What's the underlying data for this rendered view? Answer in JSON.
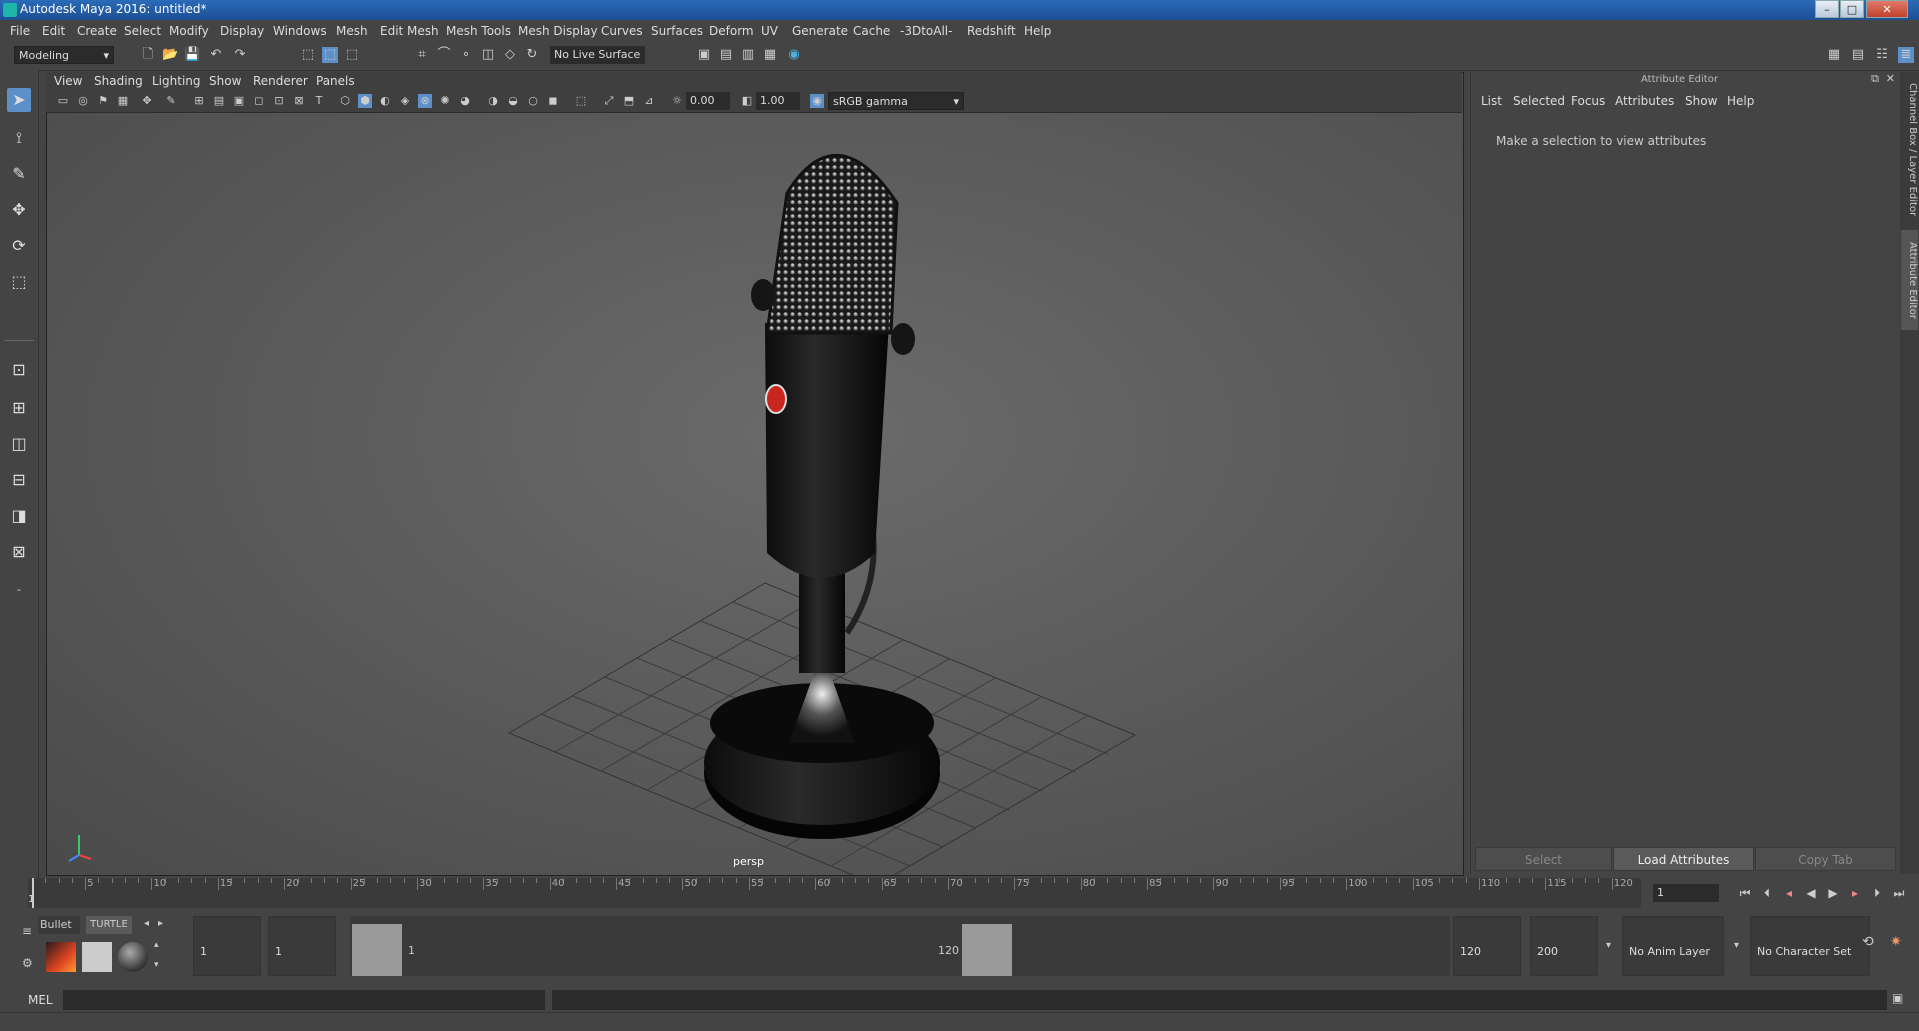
{
  "window": {
    "title": "Autodesk Maya 2016: untitled*"
  },
  "menubar": {
    "items": [
      "File",
      "Edit",
      "Create",
      "Select",
      "Modify",
      "Display",
      "Windows",
      "Mesh",
      "Edit Mesh",
      "Mesh Tools",
      "Mesh Display",
      "Curves",
      "Surfaces",
      "Deform",
      "UV",
      "Generate",
      "Cache",
      "-3DtoAll-",
      "Redshift",
      "Help"
    ]
  },
  "toolbar": {
    "mode": "Modeling",
    "live_surface": "No Live Surface"
  },
  "viewport": {
    "menu": [
      "View",
      "Shading",
      "Lighting",
      "Show",
      "Renderer",
      "Panels"
    ],
    "exposure": "0.00",
    "gamma": "1.00",
    "color_space": "sRGB gamma",
    "camera_label": "persp"
  },
  "attribute_editor": {
    "title": "Attribute Editor",
    "menu": [
      "List",
      "Selected",
      "Focus",
      "Attributes",
      "Show",
      "Help"
    ],
    "message": "Make a selection to view attributes",
    "buttons": {
      "select": "Select",
      "load": "Load Attributes",
      "copy": "Copy Tab"
    }
  },
  "side_tabs": {
    "channel_box": "Channel Box / Layer Editor",
    "attribute_editor": "Attribute Editor"
  },
  "timeline": {
    "ticks": [
      "5",
      "10",
      "15",
      "20",
      "25",
      "30",
      "35",
      "40",
      "45",
      "50",
      "55",
      "60",
      "65",
      "70",
      "75",
      "80",
      "85",
      "90",
      "95",
      "100",
      "105",
      "110",
      "115",
      "120"
    ],
    "start_label": "1",
    "current_frame": "1"
  },
  "shelf": {
    "tab_bullet": "Bullet",
    "tab_turtle": "TURTLE"
  },
  "range": {
    "start_time": "1",
    "playback_start": "1",
    "slider_start": "1",
    "slider_end": "120",
    "playback_end": "120",
    "end_time": "200",
    "anim_layer": "No Anim Layer",
    "character_set": "No Character Set"
  },
  "command_line": {
    "label": "MEL"
  }
}
